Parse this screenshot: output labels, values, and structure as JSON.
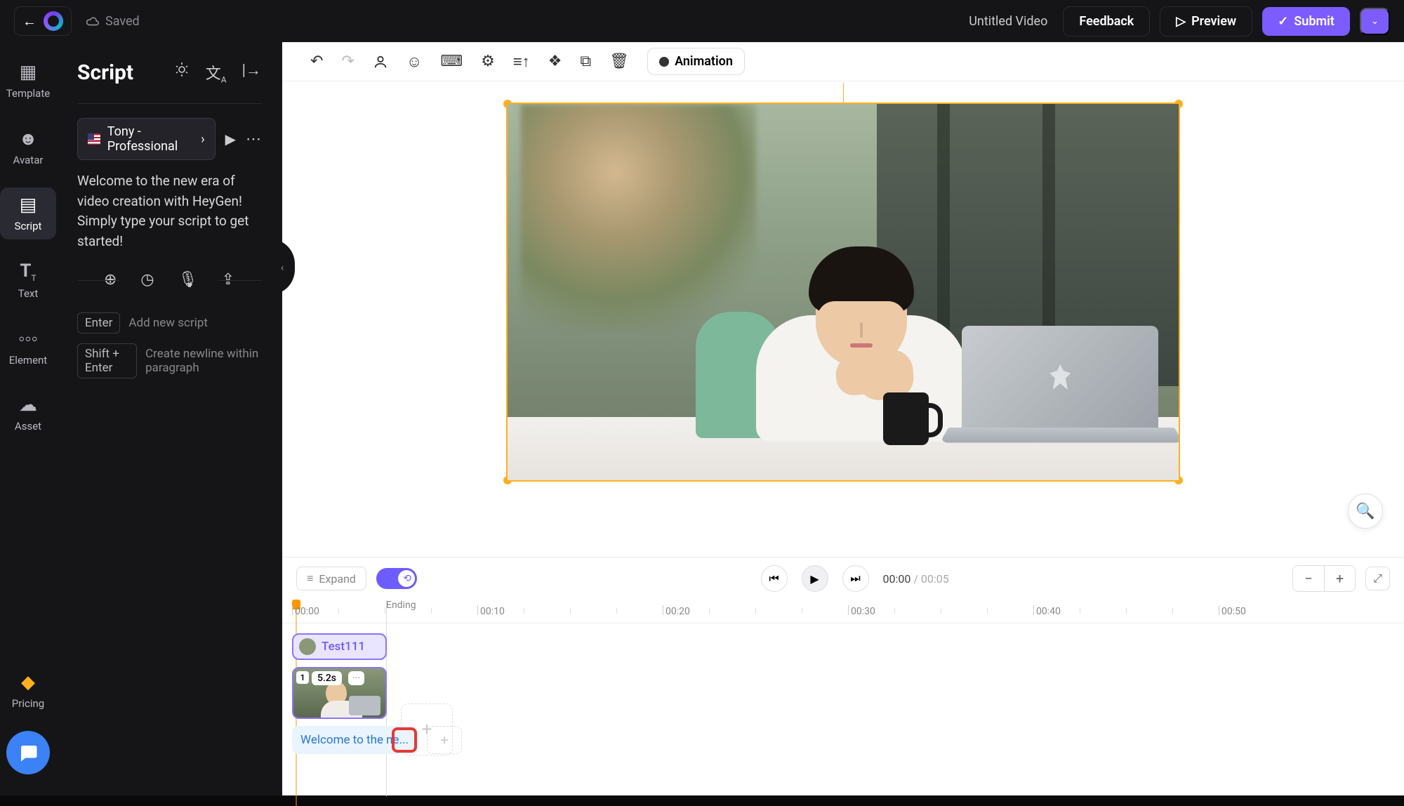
{
  "topbar": {
    "saved_label": "Saved",
    "video_title": "Untitled Video",
    "feedback": "Feedback",
    "preview": "Preview",
    "submit": "Submit"
  },
  "rail": {
    "template": "Template",
    "avatar": "Avatar",
    "script": "Script",
    "text": "Text",
    "element": "Element",
    "asset": "Asset",
    "pricing": "Pricing"
  },
  "panel": {
    "title": "Script",
    "voice": "Tony - Professional",
    "script_text": "Welcome to the new era of video creation with HeyGen! Simply type your script to get started!",
    "hint1_key": "Enter",
    "hint1_text": "Add new script",
    "hint2_key": "Shift + Enter",
    "hint2_text": "Create newline within paragraph"
  },
  "canvas": {
    "animation_btn": "Animation"
  },
  "timeline": {
    "expand": "Expand",
    "current": "00:00",
    "duration": "00:05",
    "ticks": [
      "00:00",
      "00:10",
      "00:20",
      "00:30",
      "00:40",
      "00:50"
    ],
    "ending": "Ending",
    "clip_label": "Test111",
    "thumb_index": "1",
    "thumb_duration": "5.2s",
    "thumb_more": "···",
    "caption": "Welcome to the ne..."
  }
}
